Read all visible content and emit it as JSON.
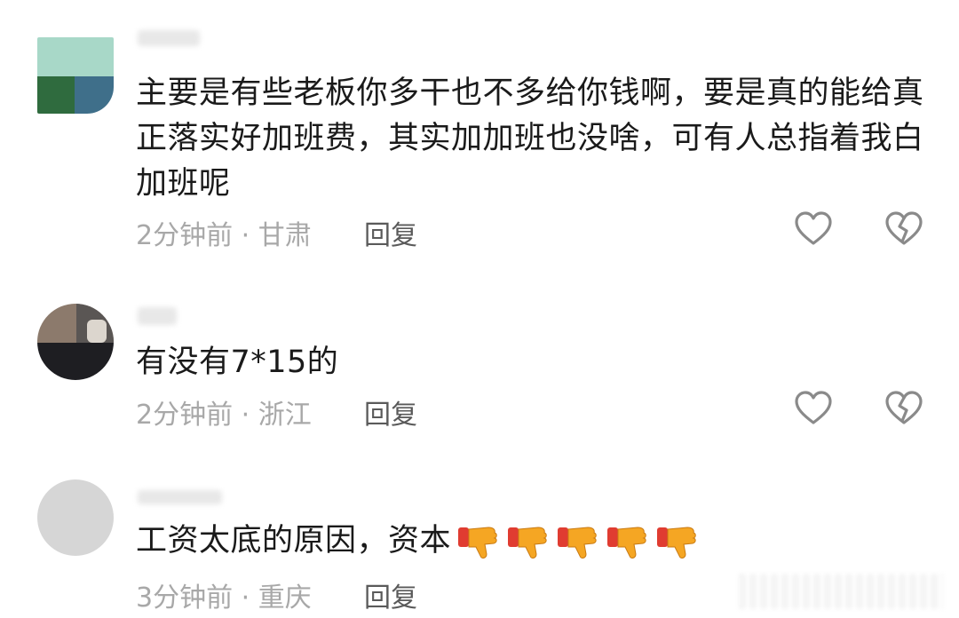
{
  "comments": [
    {
      "text": "主要是有些老板你多干也不多给你钱啊，要是真的能给真正落实好加班费，其实加加班也没啥，可有人总指着我白加班呢",
      "time": "2分钟前",
      "location": "甘肃",
      "reply": "回复"
    },
    {
      "text": "有没有7*15的",
      "time": "2分钟前",
      "location": "浙江",
      "reply": "回复"
    },
    {
      "text": "工资太底的原因，资本",
      "emoji_icons": [
        "thumbs-down-icon",
        "thumbs-down-icon",
        "thumbs-down-icon",
        "thumbs-down-icon",
        "thumbs-down-icon"
      ],
      "time": "3分钟前",
      "location": "重庆",
      "reply": "回复"
    }
  ],
  "separator": " · ",
  "colors": {
    "text": "#1a1a1a",
    "meta": "#a8a8a8",
    "reply": "#5a5a5a",
    "icon": "#8a8a8a",
    "emoji_hand": "#f5a623",
    "emoji_sleeve": "#e03c31"
  }
}
